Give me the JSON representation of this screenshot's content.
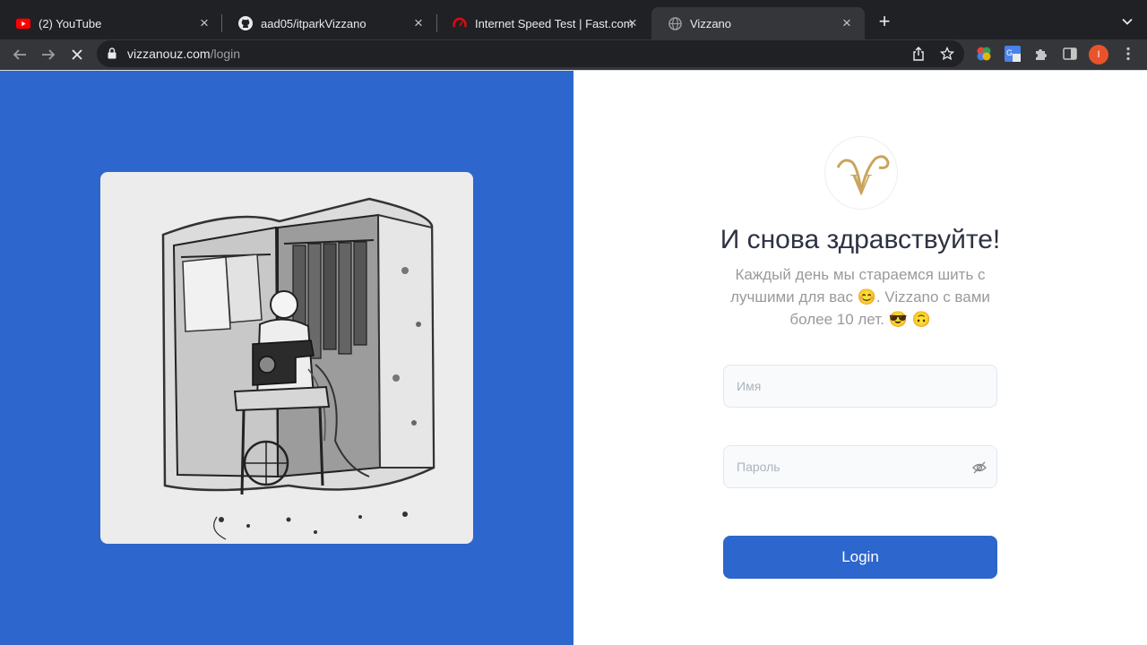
{
  "browser": {
    "tabs": [
      {
        "title": "(2) YouTube",
        "icon": "youtube-icon"
      },
      {
        "title": "aad05/itparkVizzano",
        "icon": "github-icon"
      },
      {
        "title": "Internet Speed Test | Fast.com",
        "icon": "fast-icon"
      },
      {
        "title": "Vizzano",
        "icon": "globe-icon",
        "active": true
      }
    ],
    "url_host": "vizzanouz.com",
    "url_path": "/login",
    "profile_initial": "I"
  },
  "login": {
    "logo_letter": "V",
    "heading": "И снова здравствуйте!",
    "subtitle": "Каждый день мы стараемся шить с лучшими для вас 😊. Vizzano с вами более 10 лет. 😎 🙃",
    "name_placeholder": "Имя",
    "password_placeholder": "Пароль",
    "submit_label": "Login"
  },
  "colors": {
    "brand_blue": "#2d66cc",
    "logo_gold": "#c9a55c",
    "heading": "#2e3243"
  }
}
